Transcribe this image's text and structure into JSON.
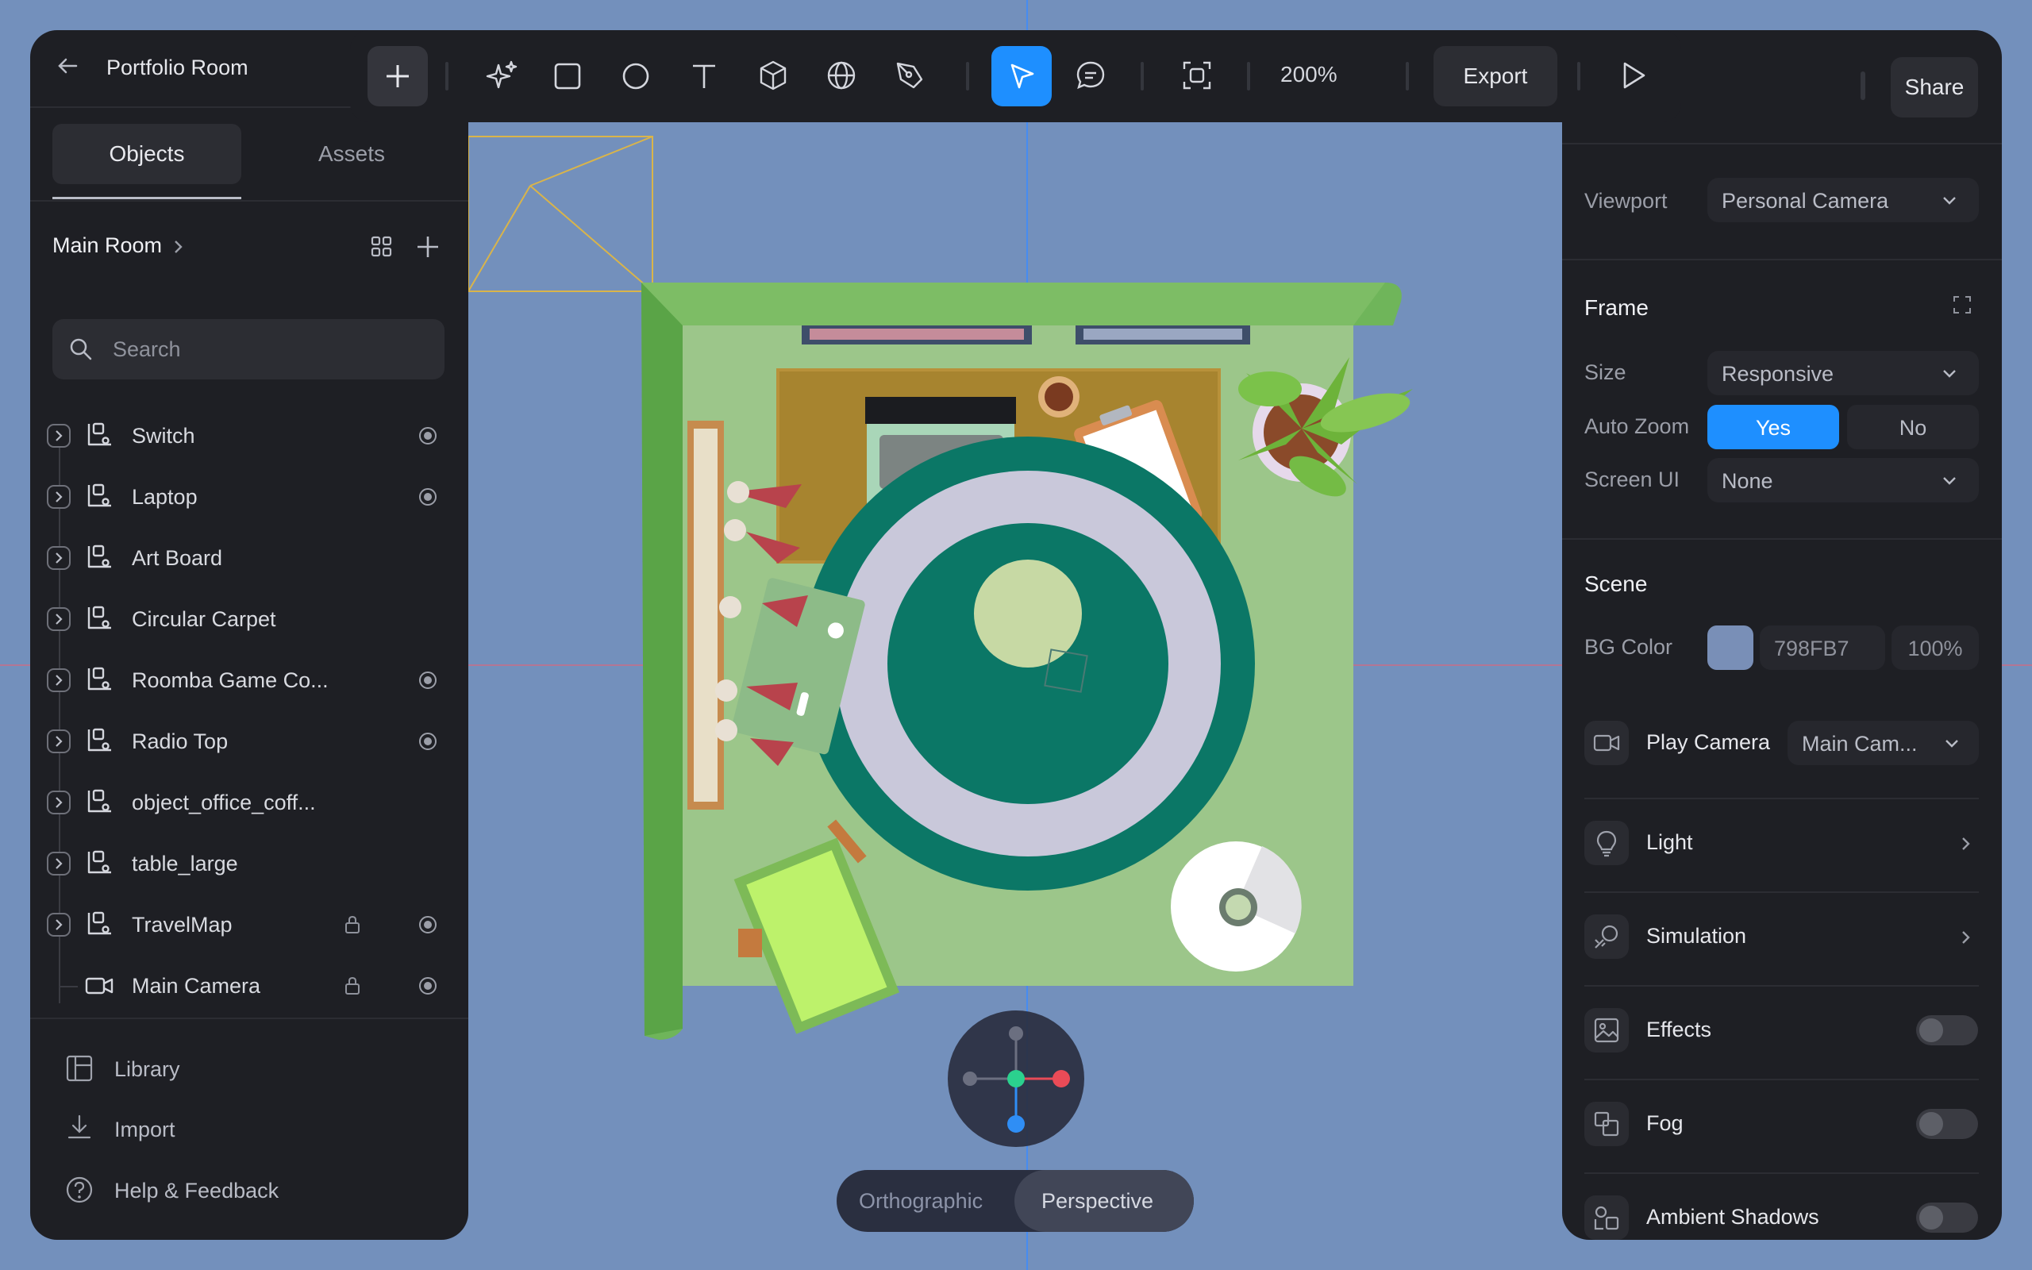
{
  "window": {
    "title": "Portfolio Room"
  },
  "left": {
    "tabs": [
      {
        "label": "Objects"
      },
      {
        "label": "Assets"
      }
    ],
    "breadcrumb": "Main Room",
    "search_placeholder": "Search",
    "layers": [
      {
        "label": "Switch",
        "locked": false,
        "visible": true,
        "icon": "group-icon"
      },
      {
        "label": "Laptop",
        "locked": false,
        "visible": true,
        "icon": "group-icon"
      },
      {
        "label": "Art Board",
        "locked": false,
        "visible": false,
        "icon": "group-icon"
      },
      {
        "label": "Circular Carpet",
        "locked": false,
        "visible": false,
        "icon": "group-icon"
      },
      {
        "label": "Roomba Game Co...",
        "locked": false,
        "visible": true,
        "icon": "group-icon"
      },
      {
        "label": "Radio Top",
        "locked": false,
        "visible": true,
        "icon": "group-icon"
      },
      {
        "label": "object_office_coff...",
        "locked": false,
        "visible": false,
        "icon": "group-icon"
      },
      {
        "label": "table_large",
        "locked": false,
        "visible": false,
        "icon": "group-icon"
      },
      {
        "label": "TravelMap",
        "locked": true,
        "visible": true,
        "icon": "group-icon"
      },
      {
        "label": "Main Camera",
        "locked": true,
        "visible": true,
        "icon": "camera-icon"
      }
    ],
    "footer": [
      {
        "label": "Library",
        "icon": "library-icon"
      },
      {
        "label": "Import",
        "icon": "import-icon"
      },
      {
        "label": "Help & Feedback",
        "icon": "help-icon"
      }
    ]
  },
  "toolbar": {
    "zoom": "200%",
    "export_label": "Export",
    "active_tool": "select"
  },
  "right": {
    "share_label": "Share",
    "viewport": {
      "label": "Viewport",
      "value": "Personal Camera"
    },
    "frame": {
      "title": "Frame",
      "size": {
        "label": "Size",
        "value": "Responsive"
      },
      "auto_zoom": {
        "label": "Auto Zoom",
        "yes": "Yes",
        "no": "No",
        "selected": "Yes"
      },
      "screen_ui": {
        "label": "Screen UI",
        "value": "None"
      }
    },
    "scene": {
      "title": "Scene",
      "bg_color": {
        "label": "BG Color",
        "hex": "798FB7",
        "opacity": "100%",
        "swatch": "#798FB7"
      }
    },
    "sections": [
      {
        "label": "Play Camera",
        "value": "Main Cam...",
        "icon": "video-camera-icon"
      },
      {
        "label": "Light",
        "icon": "lightbulb-icon"
      },
      {
        "label": "Simulation",
        "icon": "simulation-icon"
      },
      {
        "label": "Effects",
        "icon": "image-icon",
        "toggle": false
      },
      {
        "label": "Fog",
        "icon": "fog-icon",
        "toggle": false
      },
      {
        "label": "Ambient Shadows",
        "icon": "shadows-icon",
        "toggle": false
      }
    ]
  },
  "viewport": {
    "modes": [
      {
        "label": "Orthographic"
      },
      {
        "label": "Perspective"
      }
    ],
    "active_mode": "Perspective",
    "accent": "#1E8FFF",
    "canvas_bg": "#7390BC"
  }
}
